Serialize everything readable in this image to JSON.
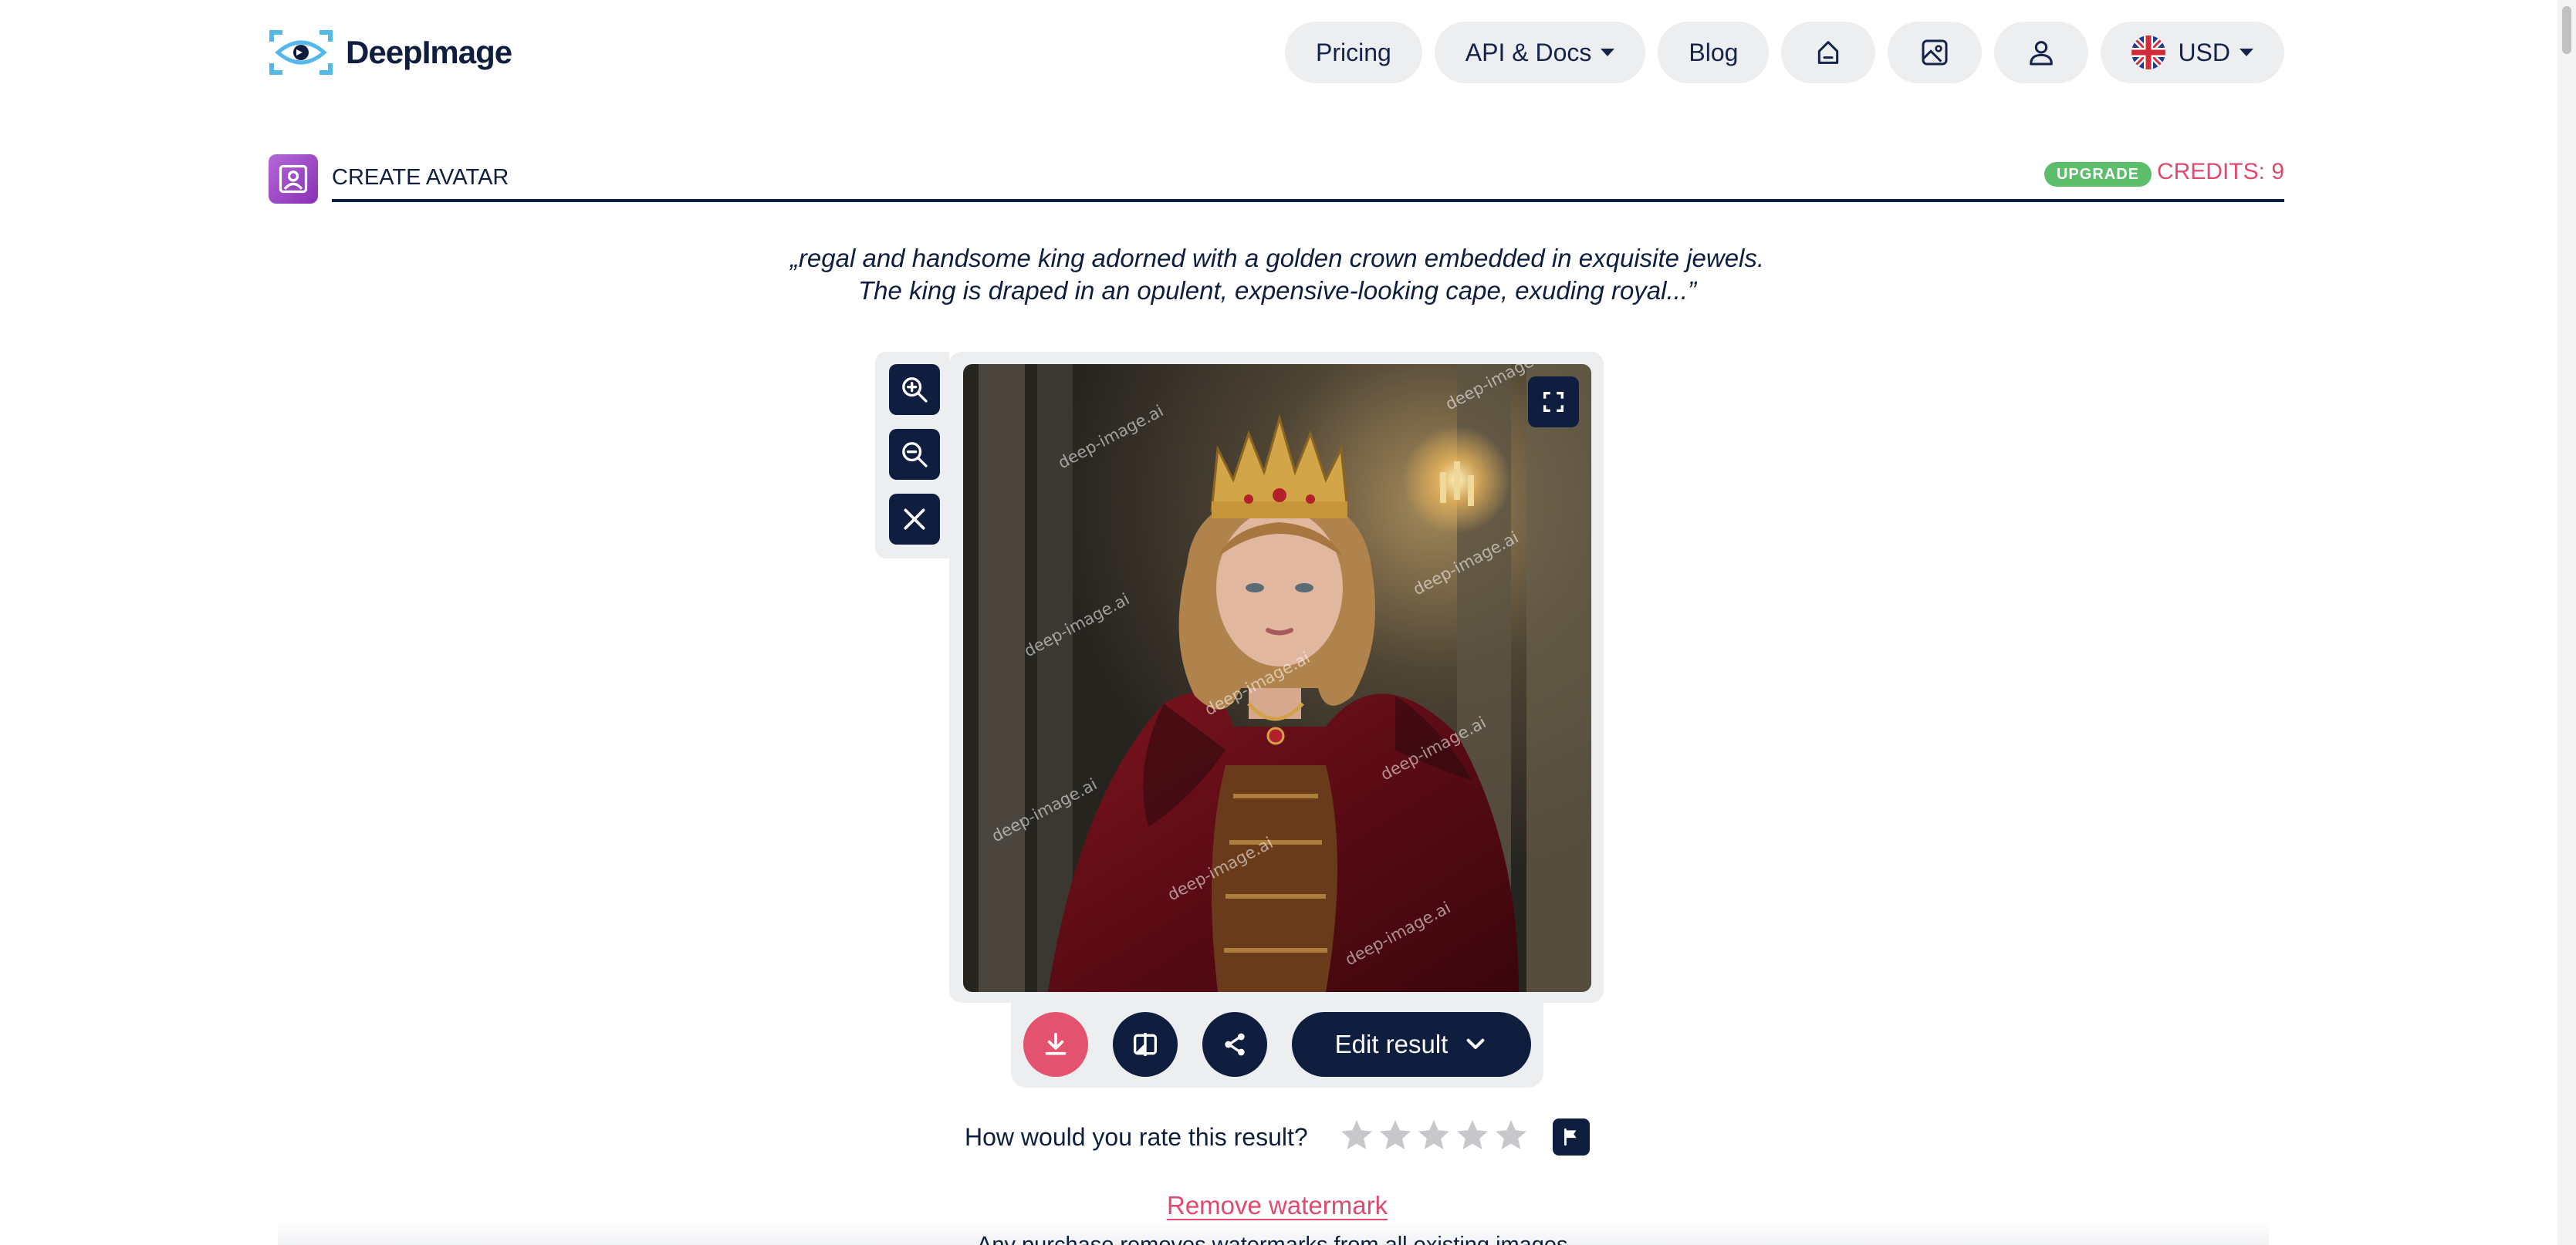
{
  "header": {
    "logo_text": "DeepImage",
    "nav": {
      "pricing": "Pricing",
      "api_docs": "API & Docs",
      "blog": "Blog",
      "home_icon": "home-icon",
      "gallery_icon": "gallery-icon",
      "account_icon": "user-icon",
      "currency": "USD"
    }
  },
  "section": {
    "title": "CREATE AVATAR",
    "upgrade_badge": "UPGRADE",
    "credits": "CREDITS: 9"
  },
  "prompt": "„regal and handsome king adorned with a golden crown embedded in exquisite jewels. The king is draped in an opulent, expensive-looking cape, exuding royal...”",
  "viewer": {
    "watermark": "deep-image.ai",
    "tools": [
      "zoom-in-icon",
      "zoom-out-icon",
      "close-icon"
    ],
    "fullscreen_icon": "fullscreen-icon"
  },
  "actions": {
    "download_icon": "download-icon",
    "compare_icon": "compare-icon",
    "share_icon": "share-icon",
    "edit_label": "Edit result"
  },
  "rating": {
    "question": "How would you rate this result?",
    "max_stars": 5,
    "current_stars": 0
  },
  "watermark_section": {
    "remove_label": "Remove watermark",
    "note": "Any purchase removes watermarks from all existing images"
  },
  "colors": {
    "navy": "#0f1d3f",
    "pink": "#e14a6e",
    "green": "#5cbd6a",
    "pill_bg": "#eceef0"
  }
}
